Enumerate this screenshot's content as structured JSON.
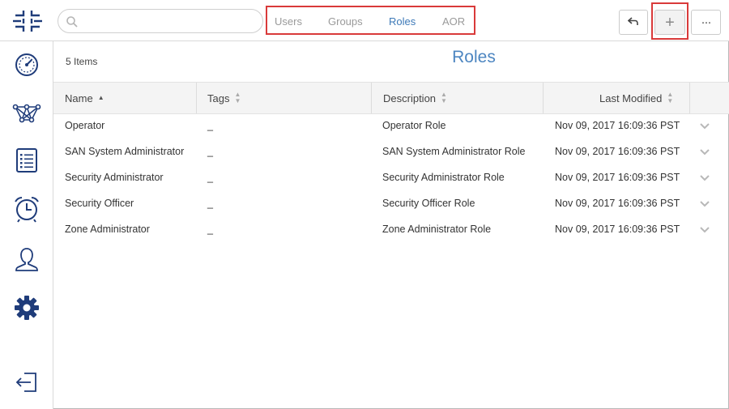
{
  "search": {
    "placeholder": "",
    "value": ""
  },
  "tabs": [
    {
      "label": "Users",
      "active": false
    },
    {
      "label": "Groups",
      "active": false
    },
    {
      "label": "Roles",
      "active": true
    },
    {
      "label": "AOR",
      "active": false
    }
  ],
  "toolbar": {
    "back_icon": "undo-arrow-icon",
    "add_label": "+",
    "more_label": "···"
  },
  "sidebar": {
    "items": [
      {
        "icon": "dashboard-gauge-icon"
      },
      {
        "icon": "network-topology-icon"
      },
      {
        "icon": "list-icon"
      },
      {
        "icon": "alarm-clock-icon"
      },
      {
        "icon": "user-icon"
      },
      {
        "icon": "gear-icon",
        "active": true
      },
      {
        "icon": "logout-icon"
      }
    ]
  },
  "main": {
    "count": "5 Items",
    "title": "Roles",
    "columns": [
      "Name",
      "Tags",
      "Description",
      "Last Modified"
    ],
    "rows": [
      {
        "name": "Operator",
        "tags": "_",
        "description": "Operator Role",
        "modified": "Nov 09, 2017 16:09:36 PST"
      },
      {
        "name": "SAN System Administrator",
        "tags": "_",
        "description": "SAN System Administrator Role",
        "modified": "Nov 09, 2017 16:09:36 PST"
      },
      {
        "name": "Security Administrator",
        "tags": "_",
        "description": "Security Administrator Role",
        "modified": "Nov 09, 2017 16:09:36 PST"
      },
      {
        "name": "Security Officer",
        "tags": "_",
        "description": "Security Officer Role",
        "modified": "Nov 09, 2017 16:09:36 PST"
      },
      {
        "name": "Zone Administrator",
        "tags": "_",
        "description": "Zone Administrator Role",
        "modified": "Nov 09, 2017 16:09:36 PST"
      }
    ]
  },
  "colors": {
    "accent": "#3e7ab8",
    "brand": "#1f3c7a",
    "highlight": "#d93a3a"
  }
}
